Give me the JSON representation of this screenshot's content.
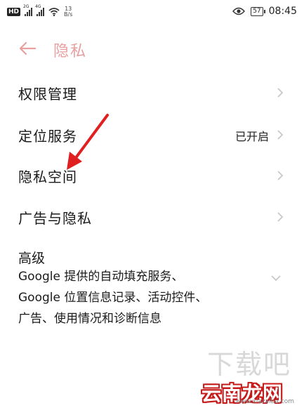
{
  "status_bar": {
    "hd": "HD",
    "sim1_type": "2G",
    "sim2_type": "4G",
    "net_speed_value": "13",
    "net_speed_unit": "B/s",
    "battery": "57",
    "time": "08:45"
  },
  "header": {
    "title": "隐私"
  },
  "items": [
    {
      "label": "权限管理",
      "value": ""
    },
    {
      "label": "定位服务",
      "value": "已开启"
    },
    {
      "label": "隐私空间",
      "value": ""
    },
    {
      "label": "广告与隐私",
      "value": ""
    }
  ],
  "advanced": {
    "title": "高级",
    "desc_lines": [
      "Google 提供的自动填充服务、",
      "Google 位置信息记录、活动控件、",
      "广告、使用情况和诊断信息"
    ]
  },
  "watermark": {
    "faint": "下载吧",
    "logo": "云南龙网",
    "url": "www.xiazaiba.com"
  },
  "colors": {
    "accent": "#e8a0a0",
    "chevron": "#c8c8c8",
    "annotation": "#e02020",
    "text": "#1a1a1a"
  }
}
